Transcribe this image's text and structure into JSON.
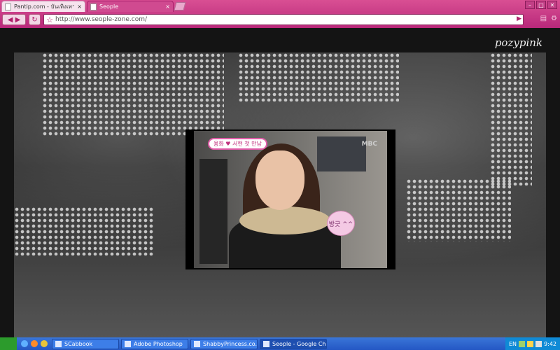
{
  "browser": {
    "tabs": [
      {
        "label": "Pantip.com - บันเทิงเทาทรี",
        "active": false
      },
      {
        "label": "Seople",
        "active": true
      }
    ],
    "address": "http://www.seople-zone.com/",
    "colors": {
      "chrome": "#c8347f",
      "accent": "#b0206a"
    }
  },
  "page": {
    "watermark": "pozypink",
    "video": {
      "channel_logo": "MBC",
      "caption": "용화 ♥ 서현 첫 만남",
      "sticker": "방긋 ^^"
    }
  },
  "taskbar": {
    "tasks": [
      {
        "label": "SCabbook",
        "active": false
      },
      {
        "label": "Adobe Photoshop",
        "active": false
      },
      {
        "label": "ShabbyPrincess.co...",
        "active": false
      },
      {
        "label": "Seople - Google Ch...",
        "active": true
      }
    ],
    "tray_lang": "EN",
    "clock": "9:42"
  }
}
